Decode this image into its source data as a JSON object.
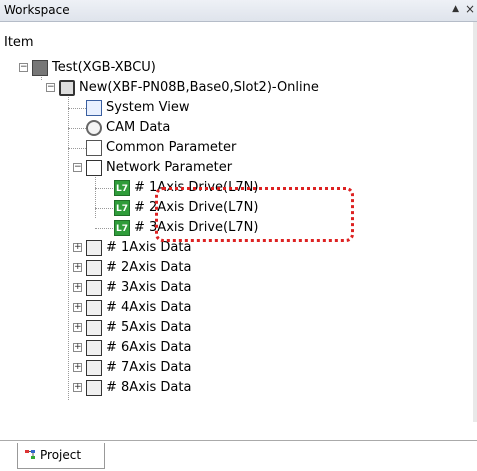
{
  "panel": {
    "title": "Workspace",
    "pin": "▲",
    "close": "×",
    "header": "Item"
  },
  "tree": [
    {
      "label": "Test(XGB-XBCU)",
      "icon": "plc-icon"
    },
    {
      "label": "New(XBF-PN08B,Base0,Slot2)-Online",
      "icon": "module-icon"
    },
    {
      "label": "System View",
      "icon": "system-view-icon"
    },
    {
      "label": "CAM Data",
      "icon": "cam-icon"
    },
    {
      "label": "Common Parameter",
      "icon": "common-parameter-icon"
    },
    {
      "label": "Network Parameter",
      "icon": "network-icon"
    },
    {
      "label": "# 1Axis Drive(L7N)",
      "icon": "l7-icon"
    },
    {
      "label": "# 2Axis Drive(L7N)",
      "icon": "l7-icon"
    },
    {
      "label": "# 3Axis Drive(L7N)",
      "icon": "l7-icon"
    },
    {
      "label": "# 1Axis Data",
      "icon": "axis-data-icon"
    },
    {
      "label": "# 2Axis Data",
      "icon": "axis-data-icon"
    },
    {
      "label": "# 3Axis Data",
      "icon": "axis-data-icon"
    },
    {
      "label": "# 4Axis Data",
      "icon": "axis-data-icon"
    },
    {
      "label": "# 5Axis Data",
      "icon": "axis-data-icon"
    },
    {
      "label": "# 6Axis Data",
      "icon": "axis-data-icon"
    },
    {
      "label": "# 7Axis Data",
      "icon": "axis-data-icon"
    },
    {
      "label": "# 8Axis Data",
      "icon": "axis-data-icon"
    }
  ],
  "tabs": {
    "project": "Project"
  },
  "icons": {
    "l7": "L7"
  },
  "colors": {
    "highlight": "#dd2222",
    "l7_green": "#2f9c3a"
  }
}
